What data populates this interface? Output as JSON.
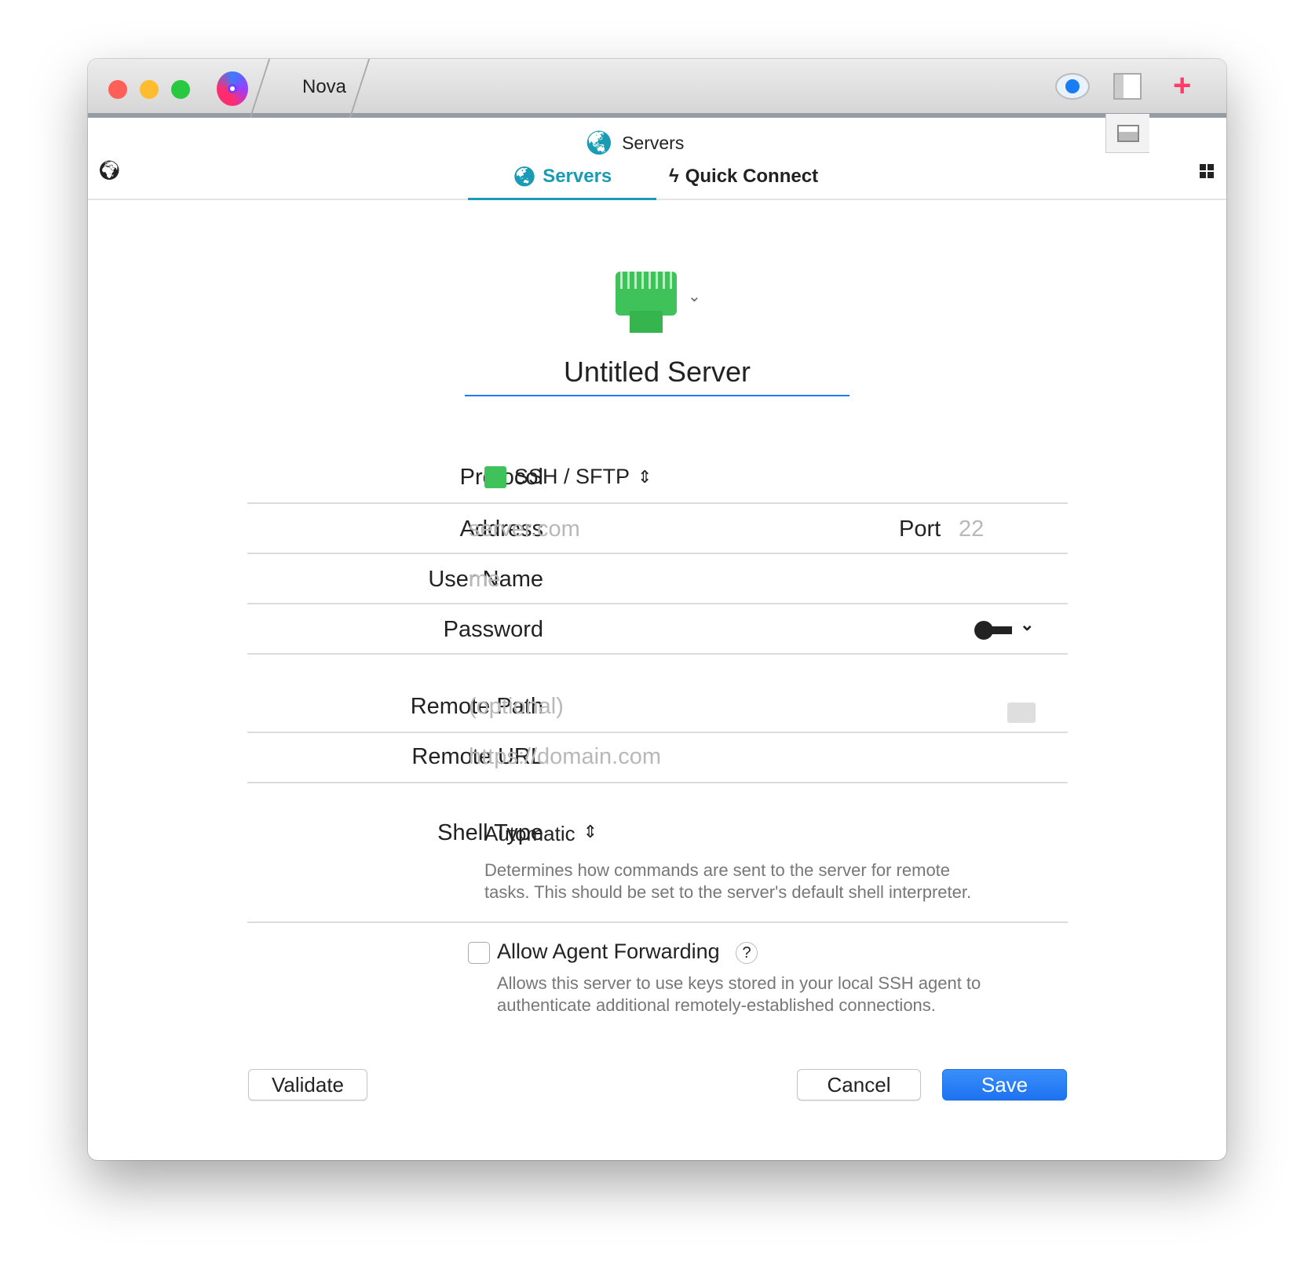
{
  "window": {
    "title": "Nova"
  },
  "header": {
    "title": "Servers"
  },
  "tabs": [
    {
      "label": "Servers",
      "active": true
    },
    {
      "label": "Quick Connect",
      "active": false
    }
  ],
  "server": {
    "name": "Untitled Server"
  },
  "form": {
    "protocol": {
      "label": "Protocol",
      "value": "SSH / SFTP"
    },
    "address": {
      "label": "Address",
      "placeholder": "server.com"
    },
    "port": {
      "label": "Port",
      "placeholder": "22"
    },
    "username": {
      "label": "User Name",
      "placeholder": "me"
    },
    "password": {
      "label": "Password"
    },
    "remote_path": {
      "label": "Remote Path",
      "placeholder": "(optional)"
    },
    "remote_url": {
      "label": "Remote URL",
      "placeholder": "https://domain.com"
    },
    "shell_type": {
      "label": "Shell Type",
      "value": "Automatic",
      "desc1": "Determines how commands are sent to the server for remote",
      "desc2": "tasks. This should be set to the server's default shell interpreter."
    },
    "agent_forwarding": {
      "label": "Allow Agent Forwarding",
      "checked": false,
      "help": "?",
      "desc1": "Allows this server to use keys stored in your local SSH agent to",
      "desc2": "authenticate additional remotely-established connections."
    }
  },
  "buttons": {
    "validate": "Validate",
    "cancel": "Cancel",
    "save": "Save"
  },
  "colors": {
    "accent": "#1a9bb5",
    "save": "#1d7cf2",
    "ssh_green": "#3fc25a"
  }
}
